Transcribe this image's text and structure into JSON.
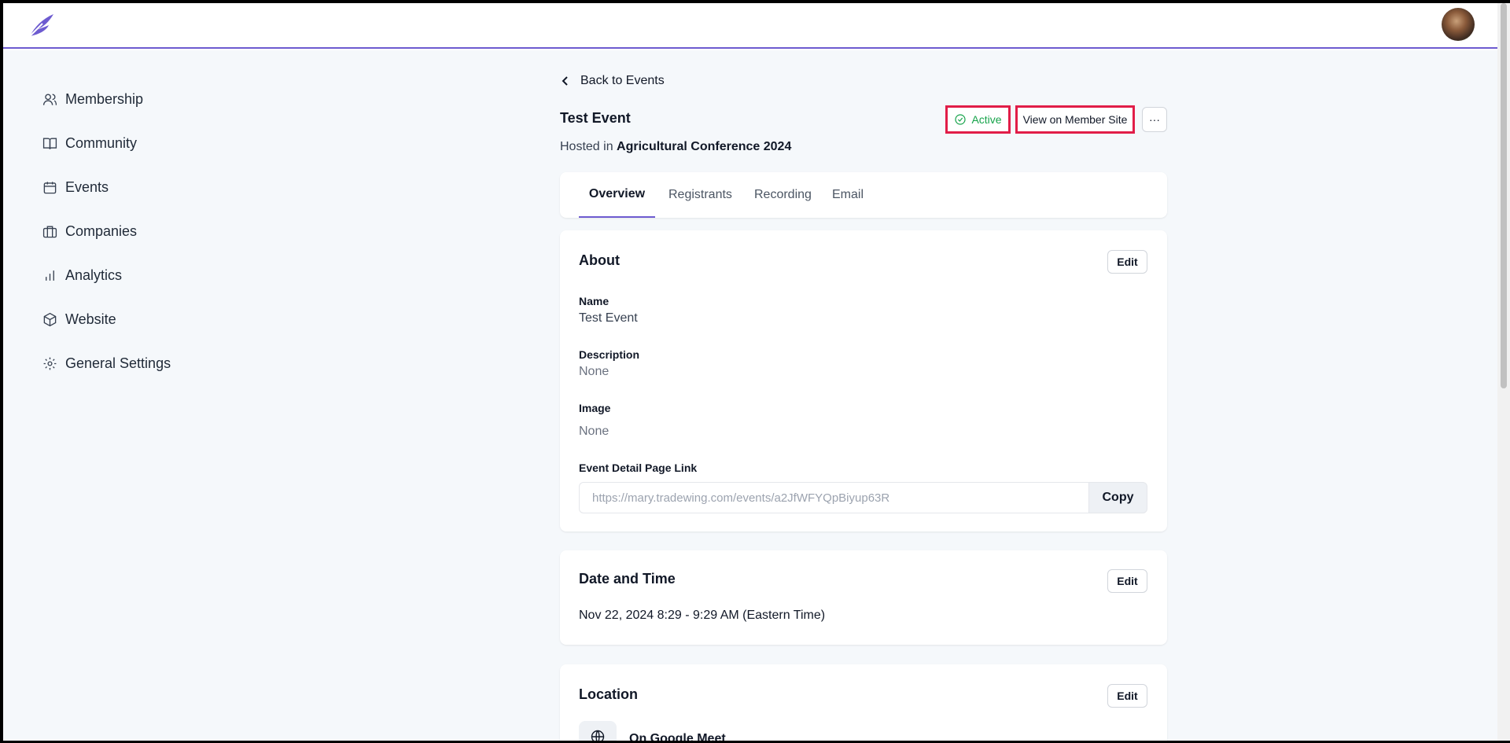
{
  "app": {
    "logo_icon": "feather-logo-icon",
    "brand_color": "#6d5bd0"
  },
  "sidebar": {
    "items": [
      {
        "label": "Membership",
        "icon": "users-icon"
      },
      {
        "label": "Community",
        "icon": "book-icon"
      },
      {
        "label": "Events",
        "icon": "calendar-icon"
      },
      {
        "label": "Companies",
        "icon": "briefcase-icon"
      },
      {
        "label": "Analytics",
        "icon": "bar-chart-icon"
      },
      {
        "label": "Website",
        "icon": "cube-icon"
      },
      {
        "label": "General Settings",
        "icon": "gear-icon"
      }
    ]
  },
  "header": {
    "back_label": "Back to Events",
    "title": "Test Event",
    "hosted_prefix": "Hosted in",
    "hosted_name": "Agricultural Conference 2024",
    "status": "Active",
    "status_color": "#16a34a",
    "view_button": "View on Member Site",
    "more_button": "···"
  },
  "tabs": [
    {
      "label": "Overview",
      "active": true
    },
    {
      "label": "Registrants",
      "active": false
    },
    {
      "label": "Recording",
      "active": false
    },
    {
      "label": "Email",
      "active": false
    }
  ],
  "about": {
    "title": "About",
    "edit": "Edit",
    "name_label": "Name",
    "name_value": "Test Event",
    "description_label": "Description",
    "description_value": "None",
    "image_label": "Image",
    "image_value": "None",
    "link_label": "Event Detail Page Link",
    "link_value": "https://mary.tradewing.com/events/a2JfWFYQpBiyup63R",
    "copy": "Copy"
  },
  "datetime": {
    "title": "Date and Time",
    "edit": "Edit",
    "value": "Nov 22, 2024 8:29 - 9:29 AM (Eastern Time)"
  },
  "location": {
    "title": "Location",
    "edit": "Edit",
    "value": "On Google Meet"
  }
}
